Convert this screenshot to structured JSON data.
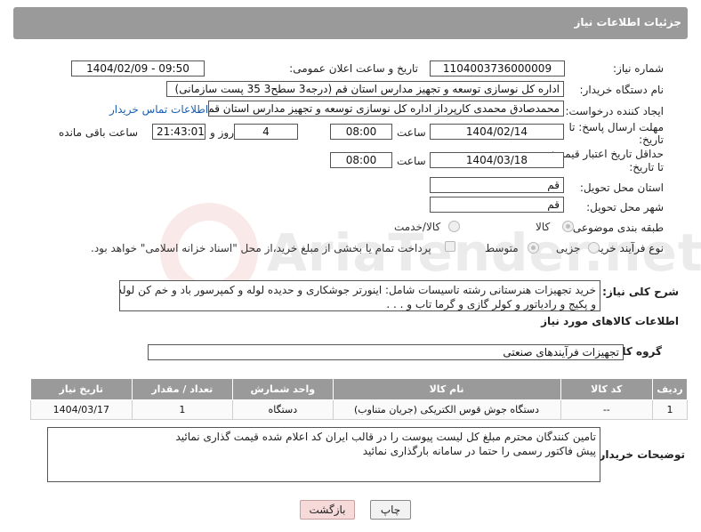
{
  "header": {
    "title": "جزئیات اطلاعات نیاز"
  },
  "watermark": {
    "text": "AriaTender.net",
    "logo": "aria-logo-icon"
  },
  "form": {
    "need_number": {
      "label": "شماره نیاز:",
      "value": "1104003736000009"
    },
    "announce_datetime": {
      "label": "تاریخ و ساعت اعلان عمومی:",
      "value": "1404/02/09 - 09:50"
    },
    "buyer_org": {
      "label": "نام دستگاه خریدار:",
      "value": "اداره کل نوسازی   توسعه و تجهیز مدارس استان قم (درجه3 سطح3  35 پست سازمانی)"
    },
    "requester": {
      "label": "ایجاد کننده درخواست:",
      "value": "محمدصادق محمدی کارپرداز  اداره کل نوسازی   توسعه و تجهیز مدارس استان قم",
      "contact_link": "اطلاعات تماس خریدار"
    },
    "deadline": {
      "label_line1": "مهلت ارسال پاسخ: تا",
      "label_line2": "تاریخ:",
      "date": "1404/02/14",
      "time_label": "ساعت",
      "time": "08:00",
      "days": "4",
      "days_label": "روز و",
      "remaining": "21:43:01",
      "remaining_label": "ساعت باقی مانده"
    },
    "validity": {
      "label_line1": "حداقل تاریخ اعتبار قیمت:",
      "label_line2": "تا تاریخ:",
      "date": "1404/03/18",
      "time_label": "ساعت",
      "time": "08:00"
    },
    "delivery_province": {
      "label": "استان محل تحویل:",
      "value": "قم"
    },
    "delivery_city": {
      "label": "شهر محل تحویل:",
      "value": "قم"
    },
    "category": {
      "label": "طبقه بندی موضوعی:",
      "options": [
        "کالا",
        "کالا/خدمت"
      ],
      "selected": "کالا"
    },
    "process_type": {
      "label": "نوع فرآیند خرید :",
      "options": [
        "جزیی",
        "متوسط"
      ],
      "selected": "متوسط",
      "payment_note": "پرداخت تمام یا بخشی از مبلغ خرید،از محل \"اسناد خزانه اسلامی\" خواهد بود."
    },
    "description": {
      "label": "شرح کلی نیاز:",
      "line1": "خرید تجهیزات هنرستانی رشته تاسیسات شامل: اینورتر جوشکاری و حدیده لوله و کمپرسور باد و خم کن لوله",
      "line2": "و پکیج و رادیاتور و کولر گازی و گرما تاب و . . ."
    }
  },
  "goods": {
    "section_title": "اطلاعات کالاهای مورد نیاز",
    "group_label": "گروه کالا:",
    "group_value": "تجهیزات فرآیندهای صنعتی",
    "columns": [
      "ردیف",
      "کد کالا",
      "نام کالا",
      "واحد شمارش",
      "تعداد / مقدار",
      "تاریخ نیاز"
    ],
    "rows": [
      {
        "row": "1",
        "code": "--",
        "name": "دستگاه جوش قوس الکتریکی (جریان متناوب)",
        "unit": "دستگاه",
        "qty": "1",
        "date": "1404/03/17"
      }
    ]
  },
  "buyer_notes": {
    "label": "توضیحات خریدار:",
    "line1": "تامین کنندگان محترم مبلغ کل لیست پیوست را در قالب ایران کد اعلام شده قیمت گذاری نمائید",
    "line2": "پیش فاکتور رسمی را حتما در سامانه بارگذاری نمائید"
  },
  "buttons": {
    "print": "چاپ",
    "back": "بازگشت"
  }
}
